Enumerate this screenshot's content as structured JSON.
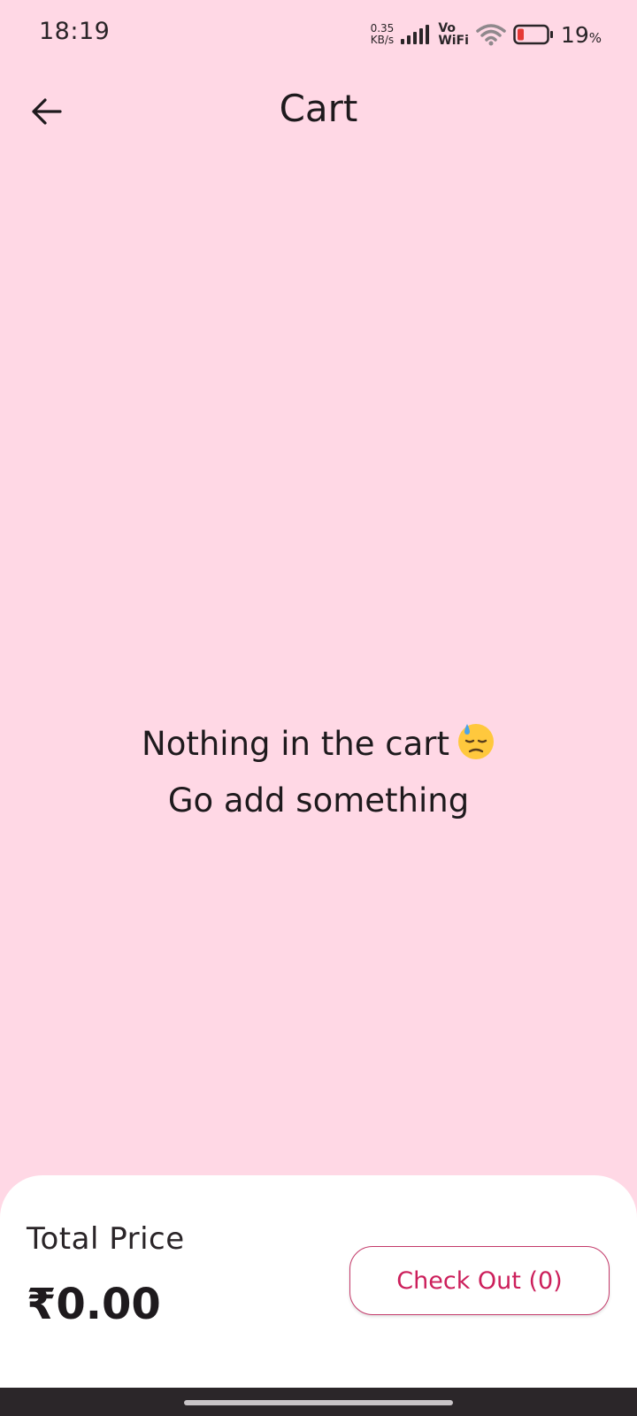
{
  "status_bar": {
    "time": "18:19",
    "net_speed_value": "0.35",
    "net_speed_unit": "KB/s",
    "volte_top": "Vo",
    "volte_bottom": "WiFi",
    "battery_percent": "19",
    "battery_percent_sign": "%",
    "icons": [
      "signal-icon",
      "wifi-icon",
      "battery-low-icon"
    ]
  },
  "app_bar": {
    "back_icon": "arrow-left-icon",
    "title": "Cart"
  },
  "empty_state": {
    "line1": "Nothing in the cart",
    "emoji_icon": "downcast-face-with-sweat-icon",
    "line2": "Go add something"
  },
  "footer": {
    "total_label": "Total Price",
    "total_value": "₹0.00",
    "checkout_label": "Check Out (0)"
  },
  "colors": {
    "background": "#ffd8e5",
    "panel": "#ffffff",
    "accent": "#cc1f5b",
    "battery_low": "#e53935",
    "nav_bar": "#2b2629"
  }
}
